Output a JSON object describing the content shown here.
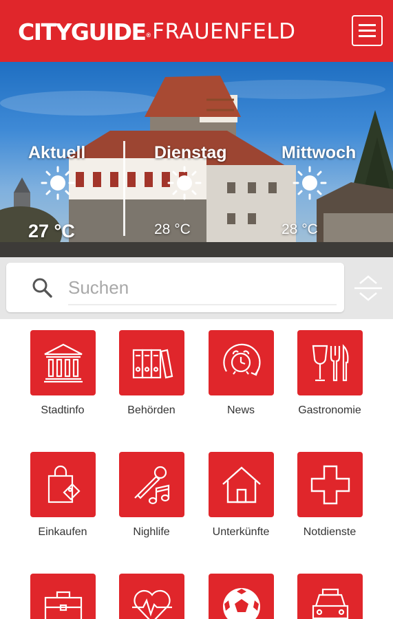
{
  "header": {
    "logo_brand": "CITYGUIDE",
    "logo_reg": "®",
    "logo_city": "FRAUENFELD",
    "menu_icon": "hamburger-menu-icon"
  },
  "weather": [
    {
      "day": "Aktuell",
      "icon": "sun-icon",
      "temp": "27 °C"
    },
    {
      "day": "Dienstag",
      "icon": "sun-icon",
      "temp": "28 °C"
    },
    {
      "day": "Mittwoch",
      "icon": "sun-icon",
      "temp": "28 °C"
    }
  ],
  "search": {
    "placeholder": "Suchen",
    "value": "",
    "icon": "search-icon",
    "toggle_icon": "expand-collapse-icon"
  },
  "categories": [
    {
      "label": "Stadtinfo",
      "icon": "city-hall-icon"
    },
    {
      "label": "Behörden",
      "icon": "binders-icon"
    },
    {
      "label": "News",
      "icon": "alarm-clock-icon"
    },
    {
      "label": "Gastronomie",
      "icon": "wine-cutlery-icon"
    },
    {
      "label": "Einkaufen",
      "icon": "shopping-bag-icon"
    },
    {
      "label": "Nighlife",
      "icon": "microphone-music-icon"
    },
    {
      "label": "Unterkünfte",
      "icon": "house-icon"
    },
    {
      "label": "Notdienste",
      "icon": "medical-cross-icon"
    },
    {
      "label": "",
      "icon": "briefcase-icon"
    },
    {
      "label": "",
      "icon": "heart-pulse-icon"
    },
    {
      "label": "",
      "icon": "soccer-ball-icon"
    },
    {
      "label": "",
      "icon": "car-icon"
    }
  ],
  "colors": {
    "brand_red": "#e0262b",
    "search_bg": "#e6e6e6",
    "label_text": "#333333"
  }
}
